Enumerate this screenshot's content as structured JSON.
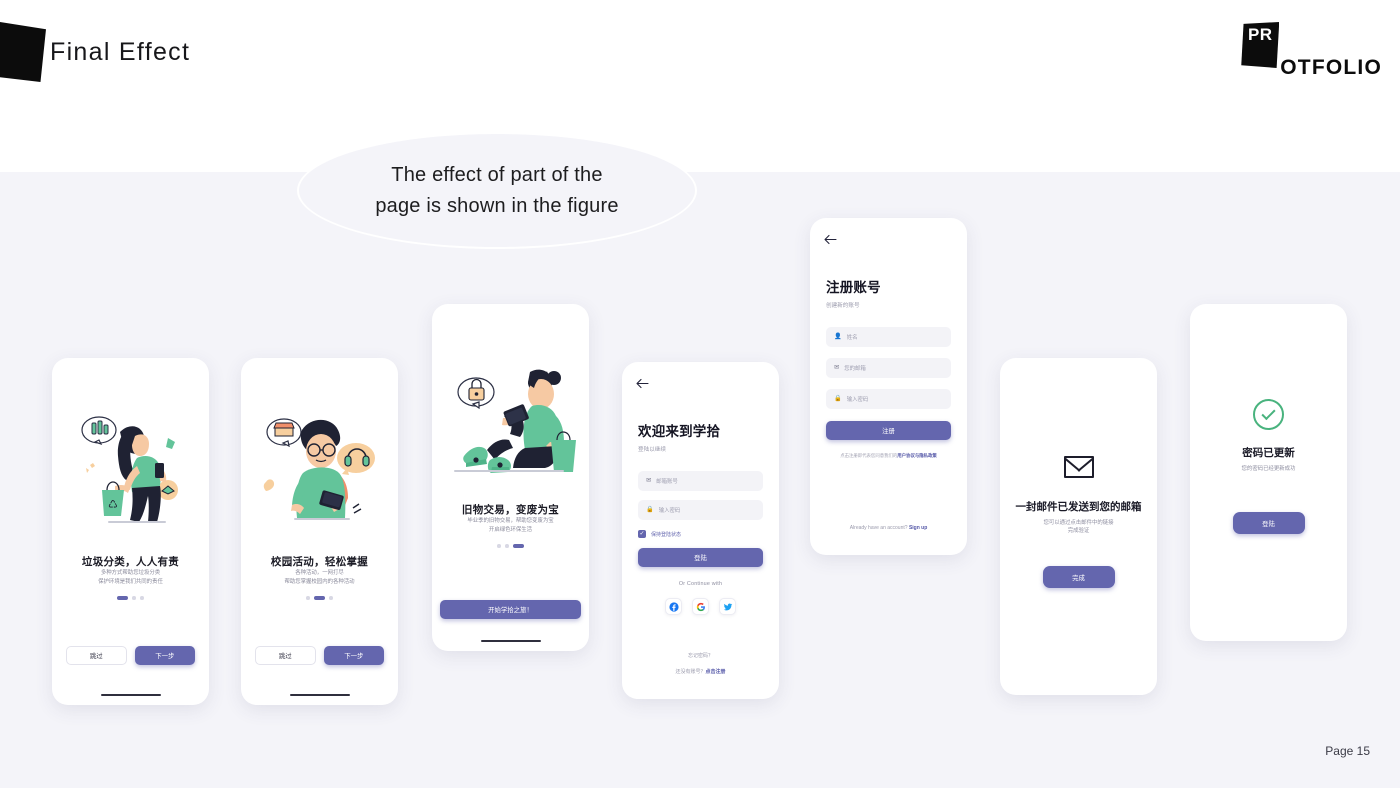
{
  "header": {
    "title": "Final Effect",
    "logo_mark": "PR",
    "logo_word": "OTFOLIO"
  },
  "callout": {
    "line1": "The effect of part of the",
    "line2": "page is shown in the figure"
  },
  "footer": {
    "page_label": "Page 15"
  },
  "colors": {
    "accent_purple": "#6466ae",
    "link_purple": "#5558a8",
    "background": "#f4f4f9",
    "success_green": "#49b37e",
    "illustration_green": "#63c49a",
    "illustration_dark": "#1f2233",
    "illustration_skin": "#f6c9a3",
    "illustration_orange": "#f6c79a"
  },
  "screens": {
    "onboarding1": {
      "title": "垃圾分类，人人有责",
      "sub_line1": "多种方式帮助您垃圾分类",
      "sub_line2": "保护环境是我们共同的责任",
      "dots": {
        "count": 3,
        "active": 0
      },
      "skip_label": "跳过",
      "next_label": "下一步"
    },
    "onboarding2": {
      "title": "校园活动，轻松掌握",
      "sub_line1": "各种活动，一网打尽",
      "sub_line2": "帮助您掌握校园内的各种活动",
      "dots": {
        "count": 3,
        "active": 1
      },
      "skip_label": "跳过",
      "next_label": "下一步"
    },
    "onboarding3": {
      "title": "旧物交易，变废为宝",
      "sub_line1": "毕业季的旧物交易，帮助您变废为宝",
      "sub_line2": "开启绿色环保生活",
      "dots": {
        "count": 3,
        "active": 2
      },
      "cta_label": "开始学拾之旅！"
    },
    "login": {
      "back_icon": "arrow-left-icon",
      "title": "欢迎来到学拾",
      "subtitle": "登陆以继续",
      "email_placeholder": "邮箱账号",
      "password_placeholder": "输入密码",
      "remember_label": "保持登陆状态",
      "remember_checked": true,
      "submit_label": "登陆",
      "or_text": "Or Continue with",
      "social": [
        "facebook-icon",
        "google-icon",
        "twitter-icon"
      ],
      "forgot_label": "忘记密码？",
      "signup_prefix": "还没有账号？",
      "signup_link": "点击注册"
    },
    "register": {
      "back_icon": "arrow-left-icon",
      "title": "注册账号",
      "subtitle": "创建新的账号",
      "name_placeholder": "姓名",
      "email_placeholder": "您的邮箱",
      "password_placeholder": "输入密码",
      "submit_label": "注册",
      "terms_prefix": "点击注册即代表您同意我们的",
      "terms_link": "用户协议与隐私政策",
      "bottom_prefix": "Already have an account? ",
      "bottom_link": "Sign up"
    },
    "email_sent": {
      "icon": "envelope-icon",
      "title": "一封邮件已发送到您的邮箱",
      "sub_line1": "您可以通过点击邮件中的链接",
      "sub_line2": "完成验证",
      "cta_label": "完成"
    },
    "password_updated": {
      "icon": "check-circle-icon",
      "title": "密码已更新",
      "subtitle": "您的密码已经更新成功",
      "cta_label": "登陆"
    }
  }
}
